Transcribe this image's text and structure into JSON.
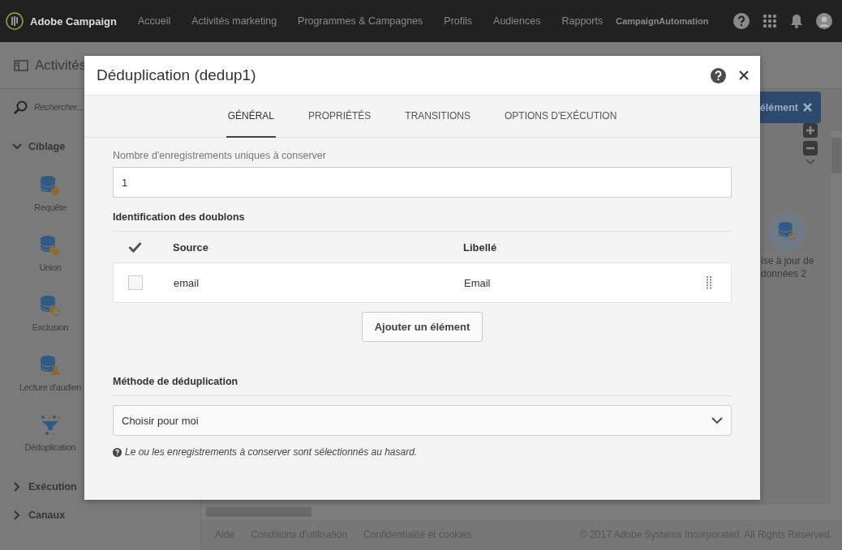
{
  "top_nav": {
    "brand": "Adobe Campaign",
    "items": [
      "Accueil",
      "Activités marketing",
      "Programmes & Campagnes",
      "Profils",
      "Audiences",
      "Rapports"
    ],
    "account": "CampaignAutomation"
  },
  "page_header": {
    "title": "Activités"
  },
  "sidebar": {
    "search_placeholder": "Rechercher...",
    "groups": [
      {
        "label": "Ciblage",
        "expanded": true,
        "items": [
          {
            "label": "Requête",
            "kind": "query"
          },
          {
            "label": "Union",
            "kind": "union"
          },
          {
            "label": "Exclusion",
            "kind": "exclusion"
          },
          {
            "label": "Lecture d'audien",
            "kind": "audience"
          },
          {
            "label": "Déduplication",
            "kind": "dedup"
          }
        ]
      },
      {
        "label": "Exécution",
        "expanded": false
      },
      {
        "label": "Canaux",
        "expanded": false
      }
    ]
  },
  "toolbar_button": "élément",
  "canvas": {
    "nodes": [
      {
        "lines": [
          "ise à jour de",
          "données 2"
        ],
        "kind": "update"
      }
    ]
  },
  "footer": {
    "links": [
      "Aide",
      "Conditions d'utilisation",
      "Confidentialité et cookies"
    ],
    "copyright": "© 2017 Adobe Systems Incorporated. All Rights Reserved."
  },
  "dialog": {
    "title": "Déduplication (dedup1)",
    "tabs": [
      {
        "label": "GÉNÉRAL",
        "selected": true
      },
      {
        "label": "PROPRIÉTÉS",
        "selected": false
      },
      {
        "label": "TRANSITIONS",
        "selected": false
      },
      {
        "label": "OPTIONS D'EXÉCUTION",
        "selected": false
      }
    ],
    "count_label": "Nombre d'enregistrements uniques à conserver",
    "count_value": "1",
    "duplicates_title": "Identification des doublons",
    "columns": [
      "Source",
      "Libellé"
    ],
    "rows": [
      {
        "source": "email",
        "label": "Email",
        "checked": false
      }
    ],
    "add_button": "Ajouter un élément",
    "method_title": "Méthode de déduplication",
    "method_value": "Choisir pour moi",
    "note": "Le ou les enregistrements à conserver sont sélectionnés au hasard."
  }
}
